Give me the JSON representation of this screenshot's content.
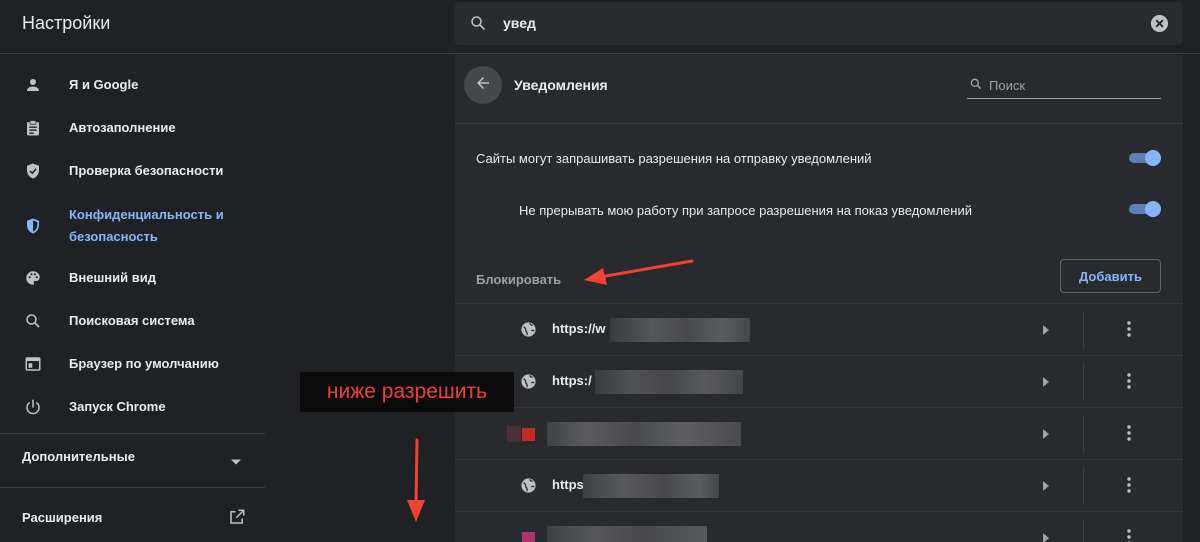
{
  "header": {
    "title": "Настройки",
    "search_value": "увед",
    "search_icon": "search-icon",
    "clear_icon": "clear-icon"
  },
  "sidebar": {
    "items": [
      {
        "label": "Я и Google",
        "icon": "person-icon"
      },
      {
        "label": "Автозаполнение",
        "icon": "clipboard-icon"
      },
      {
        "label": "Проверка безопасности",
        "icon": "shield-check-icon"
      },
      {
        "label_line1": "Конфиденциальность и",
        "label_line2": "безопасность",
        "icon": "shield-icon",
        "active": true
      },
      {
        "label": "Внешний вид",
        "icon": "palette-icon"
      },
      {
        "label": "Поисковая система",
        "icon": "search-icon"
      },
      {
        "label": "Браузер по умолчанию",
        "icon": "browser-icon"
      },
      {
        "label": "Запуск Chrome",
        "icon": "power-icon"
      }
    ],
    "advanced_label": "Дополнительные",
    "extensions_label": "Расширения"
  },
  "panel": {
    "title": "Уведомления",
    "search_placeholder": "Поиск",
    "setting_ask": "Сайты могут запрашивать разрешения на отправку уведомлений",
    "setting_quiet": "Не прерывать мою работу при запросе разрешения на показ уведомлений",
    "setting_ask_enabled": true,
    "setting_quiet_enabled": true,
    "block_section_label": "Блокировать",
    "add_button_label": "Добавить",
    "blocked_sites": [
      {
        "url_visible": "https://w",
        "icon": "globe-icon"
      },
      {
        "url_visible": "https:/",
        "icon": "globe-icon"
      },
      {
        "url_visible": "",
        "icon": "site-favicon"
      },
      {
        "url_visible": "https",
        "icon": "globe-icon"
      },
      {
        "url_visible": "",
        "icon": "site-favicon"
      }
    ]
  },
  "annotation": {
    "callout_text": "ниже разрешить",
    "color": "#ef4136"
  },
  "colors": {
    "background": "#202124",
    "panel": "#292a2d",
    "accent": "#8ab4f8"
  }
}
